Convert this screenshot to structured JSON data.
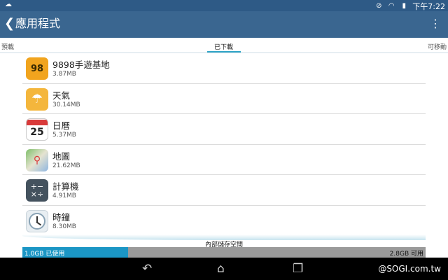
{
  "status_bar": {
    "left_icon": "cloud-upload-icon",
    "right_icons": [
      "mute-icon",
      "wifi-icon",
      "battery-charging-icon"
    ],
    "time": "下午7:22"
  },
  "app_bar": {
    "back_icon": "chevron-left-icon",
    "title": "應用程式",
    "overflow_icon": "more-vertical-icon",
    "color": "#3a6690"
  },
  "tabs": {
    "left": "預載",
    "center": "已下載",
    "right": "可移動",
    "active": "已下載",
    "accent": "#31a6c8"
  },
  "apps": [
    {
      "name": "9898手遊基地",
      "size": "3.87MB",
      "icon": "9898-games-icon",
      "glyph": "98"
    },
    {
      "name": "天氣",
      "size": "30.14MB",
      "icon": "weather-umbrella-icon",
      "glyph": "☂"
    },
    {
      "name": "日曆",
      "size": "5.37MB",
      "icon": "calendar-icon",
      "glyph": "25"
    },
    {
      "name": "地圖",
      "size": "21.62MB",
      "icon": "maps-icon",
      "glyph": "⚲"
    },
    {
      "name": "計算機",
      "size": "4.91MB",
      "icon": "calculator-icon",
      "glyph": "+−\n×÷"
    },
    {
      "name": "時鐘",
      "size": "8.30MB",
      "icon": "clock-icon",
      "glyph": ""
    }
  ],
  "storage": {
    "label": "內部儲存空間",
    "used": "1.0GB 已使用",
    "free": "2.8GB 可用",
    "used_fraction": 0.263,
    "used_color": "#1b96c5"
  },
  "nav_bar": {
    "back_icon": "back-arrow-icon",
    "home_icon": "home-icon",
    "recents_icon": "recent-apps-icon"
  },
  "watermark": "@SOGI.com.tw"
}
